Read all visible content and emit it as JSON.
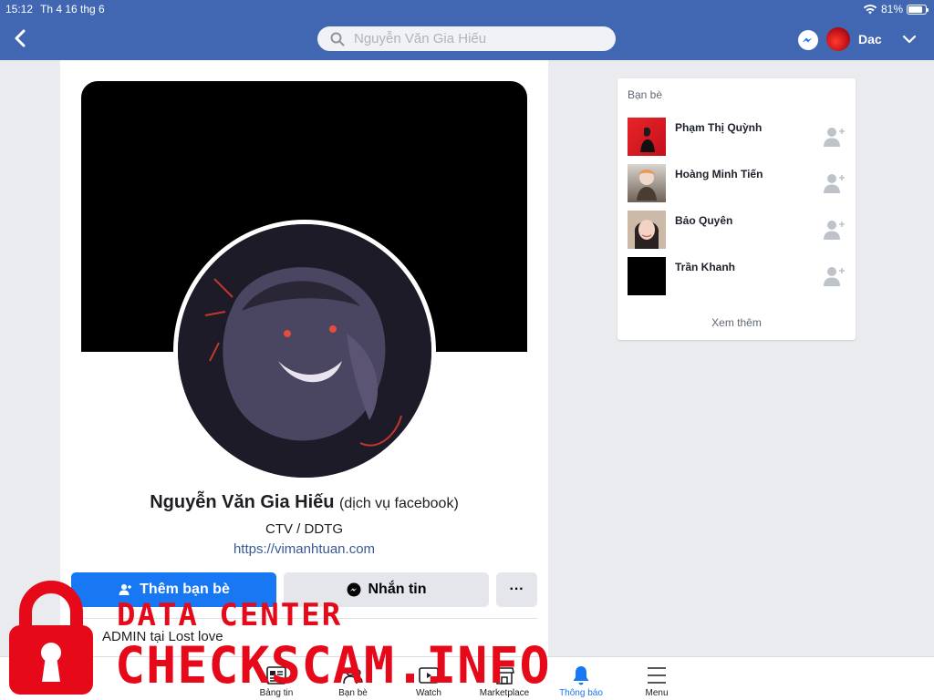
{
  "status_bar": {
    "time": "15:12",
    "date": "Th 4 16 thg 6",
    "battery": "81%",
    "battery_level": 0.81
  },
  "header": {
    "search_placeholder": "Nguyễn Văn Gia Hiếu",
    "user_name": "Dac"
  },
  "profile": {
    "name": "Nguyễn Văn Gia Hiếu",
    "name_suffix": "(dịch vụ facebook)",
    "bio": "CTV / DDTG",
    "link": "https://vimanhtuan.com",
    "add_friend_label": "Thêm bạn bè",
    "message_label": "Nhắn tin",
    "more_label": "···",
    "work": "ADMIN tại Lost love"
  },
  "friends": {
    "title": "Bạn bè",
    "items": [
      {
        "name": "Phạm Thị Quỳnh"
      },
      {
        "name": "Hoàng Minh Tiến"
      },
      {
        "name": "Bảo Quyên"
      },
      {
        "name": "Trần Khanh"
      }
    ],
    "see_more": "Xem thêm"
  },
  "tabs": [
    {
      "label": "Bảng tin",
      "icon": "news-feed-icon"
    },
    {
      "label": "Bạn bè",
      "icon": "friends-icon"
    },
    {
      "label": "Watch",
      "icon": "watch-icon"
    },
    {
      "label": "Marketplace",
      "icon": "marketplace-icon"
    },
    {
      "label": "Thông báo",
      "icon": "bell-icon",
      "active": true
    },
    {
      "label": "Menu",
      "icon": "hamburger-icon"
    }
  ],
  "watermark": {
    "line1": "DATA CENTER",
    "line2": "CHECKSCAM.INFO"
  },
  "colors": {
    "nav_bar": "#4267b2",
    "primary_button": "#1877f2",
    "watermark": "#e5091a"
  }
}
